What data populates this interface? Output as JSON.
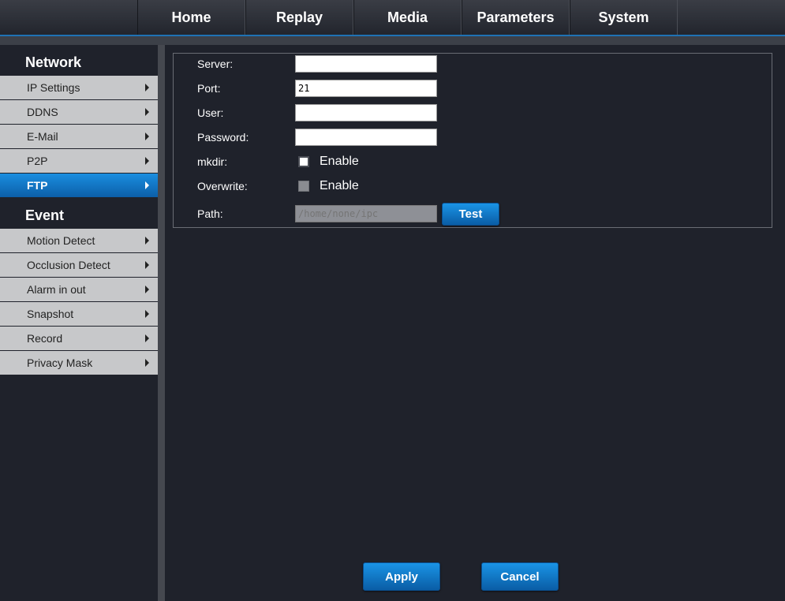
{
  "nav": {
    "items": [
      "Home",
      "Replay",
      "Media",
      "Parameters",
      "System"
    ]
  },
  "sidebar": {
    "network_title": "Network",
    "network_items": [
      {
        "label": "IP Settings",
        "active": false
      },
      {
        "label": "DDNS",
        "active": false
      },
      {
        "label": "E-Mail",
        "active": false
      },
      {
        "label": "P2P",
        "active": false
      },
      {
        "label": "FTP",
        "active": true
      }
    ],
    "event_title": "Event",
    "event_items": [
      {
        "label": "Motion Detect"
      },
      {
        "label": "Occlusion Detect"
      },
      {
        "label": "Alarm in out"
      },
      {
        "label": "Snapshot"
      },
      {
        "label": "Record"
      },
      {
        "label": "Privacy Mask"
      }
    ]
  },
  "form": {
    "server_label": "Server:",
    "server_value": "",
    "port_label": "Port:",
    "port_value": "21",
    "user_label": "User:",
    "user_value": "",
    "password_label": "Password:",
    "password_value": "",
    "mkdir_label": "mkdir:",
    "mkdir_enable_label": "Enable",
    "overwrite_label": "Overwrite:",
    "overwrite_enable_label": "Enable",
    "path_label": "Path:",
    "path_value": "/home/none/ipc",
    "test_label": "Test"
  },
  "actions": {
    "apply_label": "Apply",
    "cancel_label": "Cancel"
  },
  "colors": {
    "accent": "#1a8ee0",
    "background": "#1f222b",
    "menu_item": "#c7c8ca"
  }
}
